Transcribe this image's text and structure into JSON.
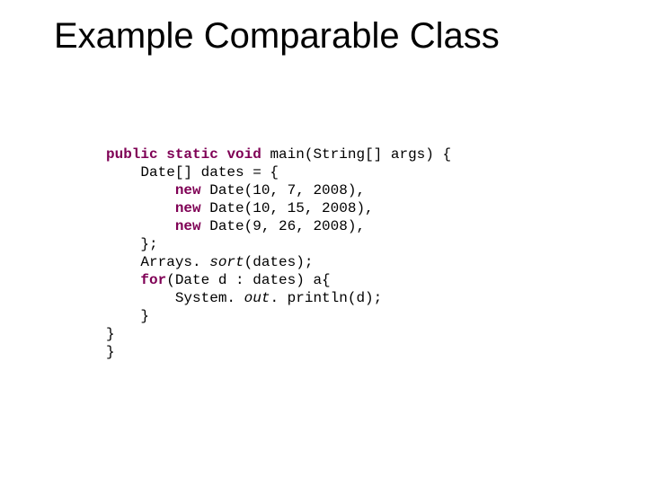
{
  "title": "Example Comparable Class",
  "code": {
    "kw_public": "public",
    "kw_static": "static",
    "kw_void": "void",
    "main_sig": " main(String[] args) {",
    "decl": "Date[] dates = {",
    "kw_new1": "new",
    "d1": " Date(10, 7, 2008),",
    "kw_new2": "new",
    "d2": " Date(10, 15, 2008),",
    "kw_new3": "new",
    "d3": " Date(9, 26, 2008),",
    "arr_close": "};",
    "arrays": "Arrays. ",
    "sort_it": "sort",
    "sort_tail": "(dates);",
    "kw_for": "for",
    "for_tail": "(Date d : dates) a{",
    "sys1": "System. ",
    "out_it": "out",
    "sys2": ". println(d);",
    "brace1": "}",
    "brace2": "}",
    "brace3": "}"
  }
}
